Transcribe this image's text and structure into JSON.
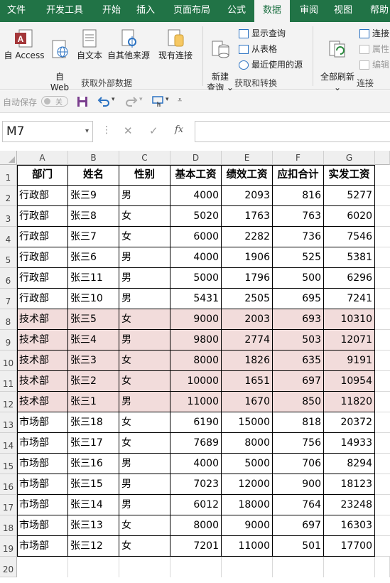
{
  "ribbon_tabs": [
    "文件",
    "开发工具",
    "开始",
    "插入",
    "页面布局",
    "公式",
    "数据",
    "审阅",
    "视图",
    "帮助"
  ],
  "active_tab": "数据",
  "groups": {
    "external": {
      "label": "获取外部数据",
      "buttons": [
        {
          "label": "自 Access",
          "icon": "access-icon"
        },
        {
          "label": "自\nWeb",
          "icon": "web-icon"
        },
        {
          "label": "自文本",
          "icon": "text-file-icon"
        },
        {
          "label": "自其他来源",
          "icon": "other-sources-icon"
        },
        {
          "label": "现有连接",
          "icon": "existing-connections-icon"
        }
      ]
    },
    "transform": {
      "label": "获取和转换",
      "new_query": "新建\n查询 ⌄",
      "items": [
        "显示查询",
        "从表格",
        "最近使用的源"
      ]
    },
    "connections": {
      "label": "连接",
      "refresh_all": "全部刷新\n⌄",
      "items": [
        "连接",
        "属性",
        "编辑"
      ]
    }
  },
  "qat": {
    "autosave_label": "自动保存",
    "autosave_state": "关"
  },
  "formula_bar": {
    "name_box": "M7",
    "formula": "",
    "fx": "fx"
  },
  "columns": [
    "A",
    "B",
    "C",
    "D",
    "E",
    "F",
    "G"
  ],
  "header_row": [
    "部门",
    "姓名",
    "性别",
    "基本工资",
    "绩效工资",
    "应扣合计",
    "实发工资"
  ],
  "rows": [
    {
      "dept": "行政部",
      "name": "张三9",
      "sex": "男",
      "base": "4000",
      "perf": "2093",
      "ded": "816",
      "net": "5277",
      "highlight": false
    },
    {
      "dept": "行政部",
      "name": "张三8",
      "sex": "女",
      "base": "5020",
      "perf": "1763",
      "ded": "763",
      "net": "6020",
      "highlight": false
    },
    {
      "dept": "行政部",
      "name": "张三7",
      "sex": "女",
      "base": "6000",
      "perf": "2282",
      "ded": "736",
      "net": "7546",
      "highlight": false
    },
    {
      "dept": "行政部",
      "name": "张三6",
      "sex": "男",
      "base": "4000",
      "perf": "1906",
      "ded": "525",
      "net": "5381",
      "highlight": false
    },
    {
      "dept": "行政部",
      "name": "张三11",
      "sex": "男",
      "base": "5000",
      "perf": "1796",
      "ded": "500",
      "net": "6296",
      "highlight": false
    },
    {
      "dept": "行政部",
      "name": "张三10",
      "sex": "男",
      "base": "5431",
      "perf": "2505",
      "ded": "695",
      "net": "7241",
      "highlight": false
    },
    {
      "dept": "技术部",
      "name": "张三5",
      "sex": "女",
      "base": "9000",
      "perf": "2003",
      "ded": "693",
      "net": "10310",
      "highlight": true
    },
    {
      "dept": "技术部",
      "name": "张三4",
      "sex": "男",
      "base": "9800",
      "perf": "2774",
      "ded": "503",
      "net": "12071",
      "highlight": true
    },
    {
      "dept": "技术部",
      "name": "张三3",
      "sex": "女",
      "base": "8000",
      "perf": "1826",
      "ded": "635",
      "net": "9191",
      "highlight": true
    },
    {
      "dept": "技术部",
      "name": "张三2",
      "sex": "女",
      "base": "10000",
      "perf": "1651",
      "ded": "697",
      "net": "10954",
      "highlight": true
    },
    {
      "dept": "技术部",
      "name": "张三1",
      "sex": "男",
      "base": "11000",
      "perf": "1670",
      "ded": "850",
      "net": "11820",
      "highlight": true
    },
    {
      "dept": "市场部",
      "name": "张三18",
      "sex": "女",
      "base": "6190",
      "perf": "15000",
      "ded": "818",
      "net": "20372",
      "highlight": false
    },
    {
      "dept": "市场部",
      "name": "张三17",
      "sex": "女",
      "base": "7689",
      "perf": "8000",
      "ded": "756",
      "net": "14933",
      "highlight": false
    },
    {
      "dept": "市场部",
      "name": "张三16",
      "sex": "男",
      "base": "4000",
      "perf": "5000",
      "ded": "706",
      "net": "8294",
      "highlight": false
    },
    {
      "dept": "市场部",
      "name": "张三15",
      "sex": "男",
      "base": "7023",
      "perf": "12000",
      "ded": "900",
      "net": "18123",
      "highlight": false
    },
    {
      "dept": "市场部",
      "name": "张三14",
      "sex": "男",
      "base": "6012",
      "perf": "18000",
      "ded": "764",
      "net": "23248",
      "highlight": false
    },
    {
      "dept": "市场部",
      "name": "张三13",
      "sex": "女",
      "base": "8000",
      "perf": "9000",
      "ded": "697",
      "net": "16303",
      "highlight": false
    },
    {
      "dept": "市场部",
      "name": "张三12",
      "sex": "女",
      "base": "7201",
      "perf": "11000",
      "ded": "501",
      "net": "17700",
      "highlight": false
    }
  ],
  "row_numbers": [
    "1",
    "2",
    "3",
    "4",
    "5",
    "6",
    "7",
    "8",
    "9",
    "10",
    "11",
    "12",
    "13",
    "14",
    "15",
    "16",
    "17",
    "18",
    "19",
    "20"
  ],
  "colors": {
    "accent": "#217346",
    "highlight": "#f2dcdb"
  }
}
